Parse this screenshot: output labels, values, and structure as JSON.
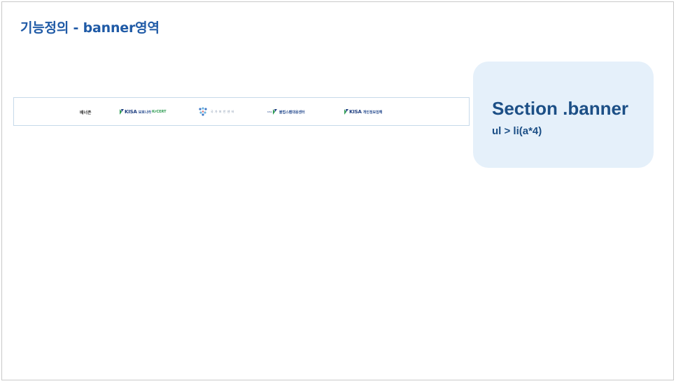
{
  "page": {
    "title": "기능정의 - banner영역"
  },
  "banner": {
    "items": [
      {
        "label": "배너존"
      },
      {
        "brand": "KISA",
        "sub": "보호나라",
        "extra": "KrCERT"
      },
      {
        "text": "국 가 보 안 센 터"
      },
      {
        "prefix": "KISA",
        "text": "불법스팸대응센터"
      },
      {
        "brand": "KISA",
        "sub": "개인정보침해"
      }
    ]
  },
  "callout": {
    "title": "Section .banner",
    "subtitle": "ul > li(a*4)"
  },
  "colors": {
    "title": "#1f5aa6",
    "callout_bg": "#e5f0fa",
    "callout_text": "#1c4f86",
    "banner_border": "#c6d9ea",
    "kisa_green": "#2e9c52",
    "kisa_blue": "#1f3f80"
  },
  "icons": [
    "kisa-logo-icon",
    "government-emblem-icon"
  ]
}
